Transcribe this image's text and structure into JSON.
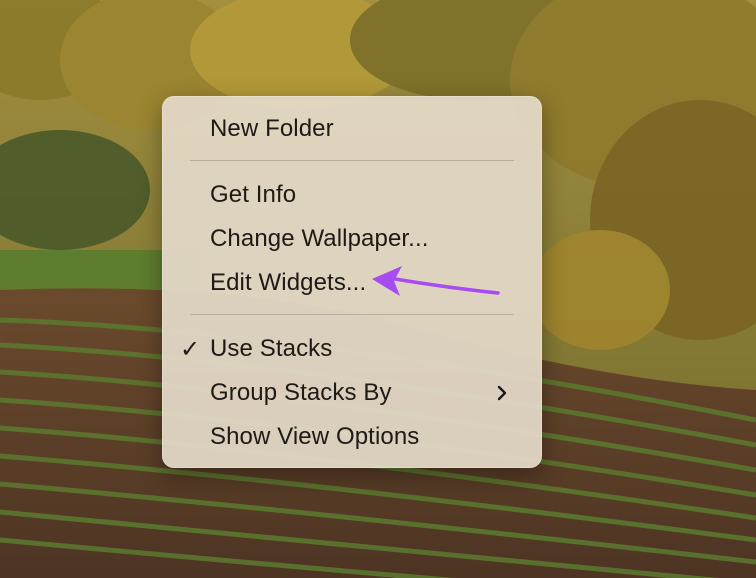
{
  "menu": {
    "items": [
      {
        "label": "New Folder"
      },
      {
        "label": "Get Info"
      },
      {
        "label": "Change Wallpaper..."
      },
      {
        "label": "Edit Widgets..."
      },
      {
        "label": "Use Stacks",
        "checked": true
      },
      {
        "label": "Group Stacks By",
        "has_submenu": true
      },
      {
        "label": "Show View Options"
      }
    ]
  },
  "icons": {
    "check": "checkmark-icon",
    "submenu": "chevron-right-icon"
  },
  "colors": {
    "menu_background": "#e4d9c8",
    "menu_text": "#1e1a16",
    "annotation_arrow": "#a64cf0"
  }
}
